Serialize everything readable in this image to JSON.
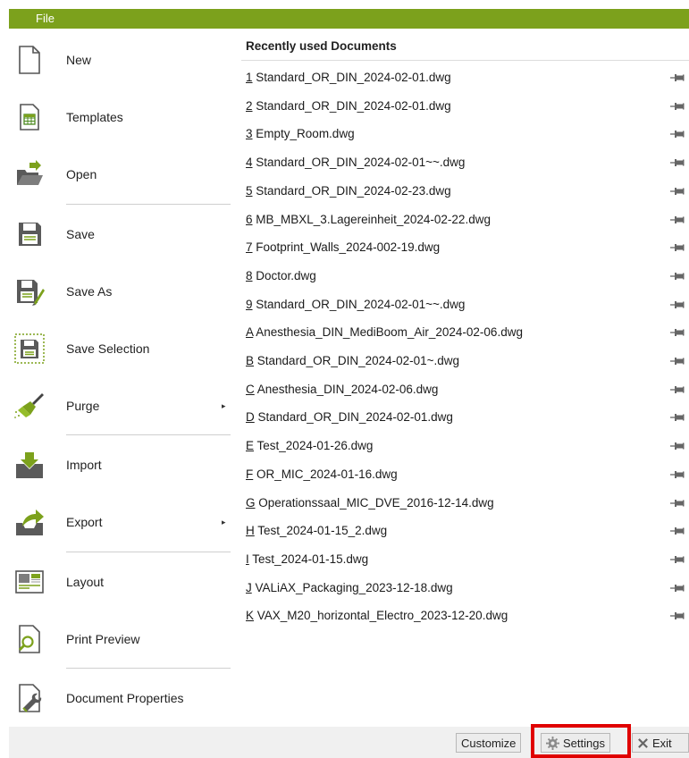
{
  "header": {
    "file_tab": "File"
  },
  "menu": [
    {
      "label": "New",
      "icon": "new-document-icon",
      "name": "menu-item-new"
    },
    {
      "label": "Templates",
      "icon": "templates-icon",
      "name": "menu-item-templates"
    },
    {
      "label": "Open",
      "icon": "open-folder-icon",
      "name": "menu-item-open"
    },
    {
      "label": "Save",
      "icon": "save-icon",
      "name": "menu-item-save"
    },
    {
      "label": "Save As",
      "icon": "save-as-icon",
      "name": "menu-item-save-as"
    },
    {
      "label": "Save Selection",
      "icon": "save-selection-icon",
      "name": "menu-item-save-selection"
    },
    {
      "label": "Purge",
      "icon": "purge-broom-icon",
      "name": "menu-item-purge",
      "submenu": true
    },
    {
      "label": "Import",
      "icon": "import-icon",
      "name": "menu-item-import"
    },
    {
      "label": "Export",
      "icon": "export-icon",
      "name": "menu-item-export",
      "submenu": true
    },
    {
      "label": "Layout",
      "icon": "layout-icon",
      "name": "menu-item-layout"
    },
    {
      "label": "Print Preview",
      "icon": "print-preview-icon",
      "name": "menu-item-print-preview"
    },
    {
      "label": "Document Properties",
      "icon": "document-properties-icon",
      "name": "menu-item-document-properties"
    }
  ],
  "recent": {
    "title": "Recently used Documents",
    "documents": [
      {
        "key": "1",
        "name": "Standard_OR_DIN_2024-02-01.dwg"
      },
      {
        "key": "2",
        "name": "Standard_OR_DIN_2024-02-01.dwg"
      },
      {
        "key": "3",
        "name": "Empty_Room.dwg"
      },
      {
        "key": "4",
        "name": "Standard_OR_DIN_2024-02-01~~.dwg"
      },
      {
        "key": "5",
        "name": "Standard_OR_DIN_2024-02-23.dwg"
      },
      {
        "key": "6",
        "name": "MB_MBXL_3.Lagereinheit_2024-02-22.dwg"
      },
      {
        "key": "7",
        "name": "Footprint_Walls_2024-002-19.dwg"
      },
      {
        "key": "8",
        "name": "Doctor.dwg"
      },
      {
        "key": "9",
        "name": "Standard_OR_DIN_2024-02-01~~.dwg"
      },
      {
        "key": "A",
        "name": "Anesthesia_DIN_MediBoom_Air_2024-02-06.dwg"
      },
      {
        "key": "B",
        "name": "Standard_OR_DIN_2024-02-01~.dwg"
      },
      {
        "key": "C",
        "name": "Anesthesia_DIN_2024-02-06.dwg"
      },
      {
        "key": "D",
        "name": "Standard_OR_DIN_2024-02-01.dwg"
      },
      {
        "key": "E",
        "name": "Test_2024-01-26.dwg"
      },
      {
        "key": "F",
        "name": "OR_MIC_2024-01-16.dwg"
      },
      {
        "key": "G",
        "name": "Operationssaal_MIC_DVE_2016-12-14.dwg"
      },
      {
        "key": "H",
        "name": "Test_2024-01-15_2.dwg"
      },
      {
        "key": "I",
        "name": "Test_2024-01-15.dwg"
      },
      {
        "key": "J",
        "name": "VALiAX_Packaging_2023-12-18.dwg"
      },
      {
        "key": "K",
        "name": "VAX_M20_horizontal_Electro_2023-12-20.dwg"
      }
    ]
  },
  "footer": {
    "customize_label": "Customize",
    "settings_label": "Settings",
    "exit_label": "Exit"
  },
  "colors": {
    "accent": "#7ca11c",
    "highlight": "#e00000"
  }
}
